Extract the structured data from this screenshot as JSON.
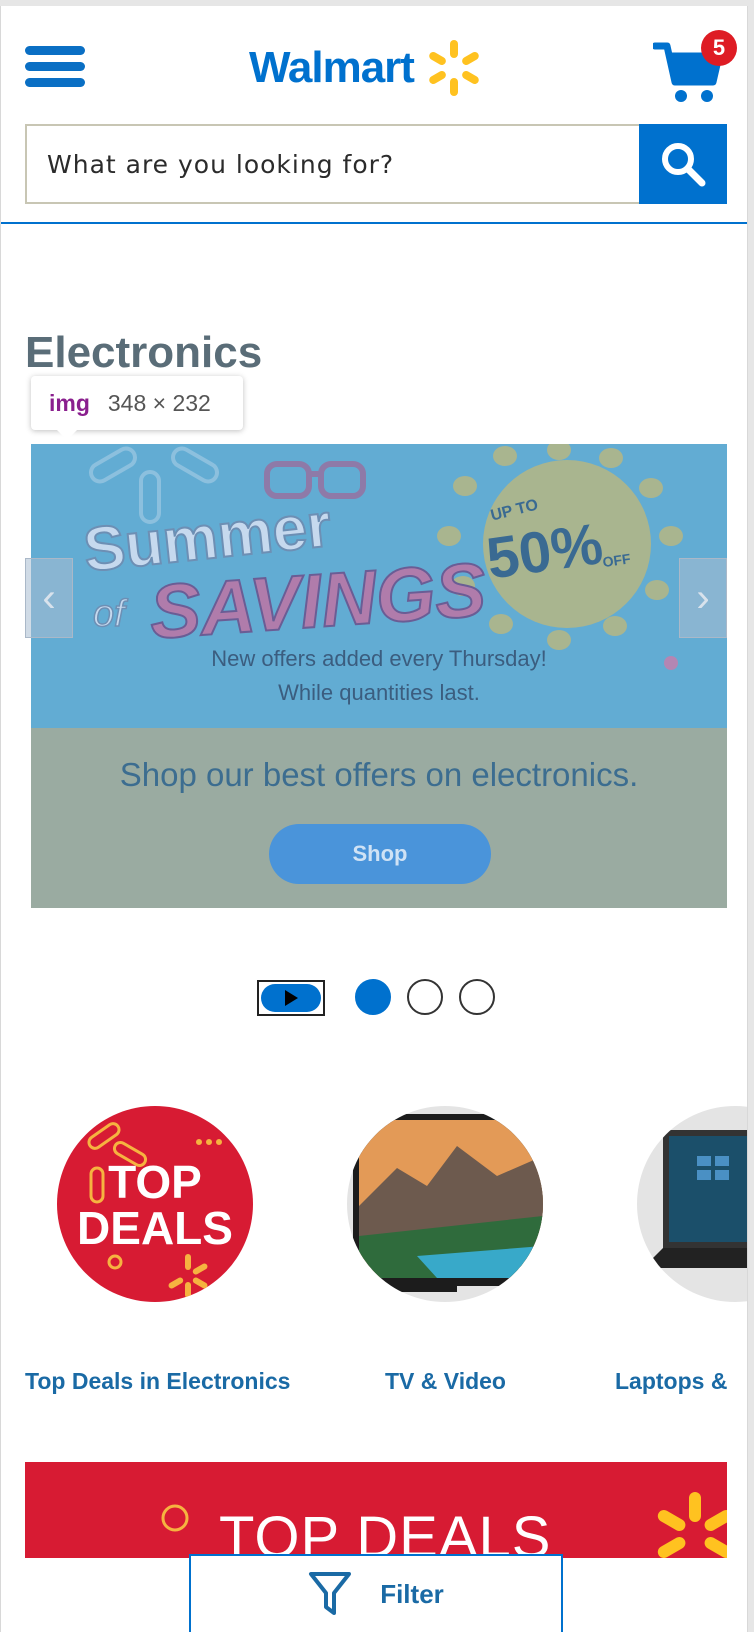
{
  "header": {
    "logo_text": "Walmart",
    "cart_count": "5",
    "menu_icon": "hamburger-icon",
    "cart_icon": "cart-icon"
  },
  "search": {
    "placeholder": "What are you looking for?",
    "button_icon": "search-icon"
  },
  "section": {
    "title": "Electronics"
  },
  "devtools_tooltip": {
    "tag": "img",
    "size": "348 × 232"
  },
  "banner": {
    "headline_line1": "Summer",
    "headline_of": "of",
    "headline_line2": "SAVINGS",
    "badge_upto": "UP TO",
    "badge_percent": "50%",
    "badge_off": "OFF",
    "offers_line1": "New offers added every Thursday!",
    "offers_line2": "While quantities last.",
    "caption": "Shop our best offers on electronics.",
    "shop_label": "Shop",
    "prev_arrow": "‹",
    "next_arrow": "›"
  },
  "carousel": {
    "slide_count": 3,
    "active_slide": 1
  },
  "categories": [
    {
      "label": "Top Deals in Electronics",
      "badge_line1": "TOP",
      "badge_line2": "DEALS"
    },
    {
      "label": "TV & Video"
    },
    {
      "label": "Laptops &"
    }
  ],
  "deals_banner": {
    "text": "TOP DEALS"
  },
  "filter": {
    "label": "Filter",
    "icon": "filter-icon"
  },
  "colors": {
    "brand_blue": "#0071ce",
    "spark_yellow": "#ffc220",
    "deal_red": "#d71b33",
    "badge_red": "#de1c24"
  }
}
